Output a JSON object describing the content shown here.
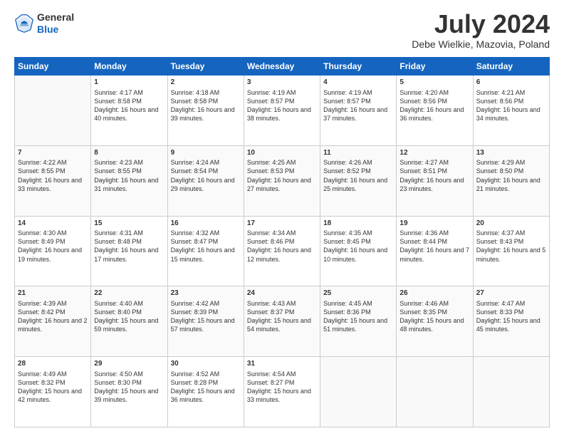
{
  "header": {
    "logo_general": "General",
    "logo_blue": "Blue",
    "month_title": "July 2024",
    "location": "Debe Wielkie, Mazovia, Poland"
  },
  "days_of_week": [
    "Sunday",
    "Monday",
    "Tuesday",
    "Wednesday",
    "Thursday",
    "Friday",
    "Saturday"
  ],
  "weeks": [
    [
      {
        "num": "",
        "sunrise": "",
        "sunset": "",
        "daylight": ""
      },
      {
        "num": "1",
        "sunrise": "Sunrise: 4:17 AM",
        "sunset": "Sunset: 8:58 PM",
        "daylight": "Daylight: 16 hours and 40 minutes."
      },
      {
        "num": "2",
        "sunrise": "Sunrise: 4:18 AM",
        "sunset": "Sunset: 8:58 PM",
        "daylight": "Daylight: 16 hours and 39 minutes."
      },
      {
        "num": "3",
        "sunrise": "Sunrise: 4:19 AM",
        "sunset": "Sunset: 8:57 PM",
        "daylight": "Daylight: 16 hours and 38 minutes."
      },
      {
        "num": "4",
        "sunrise": "Sunrise: 4:19 AM",
        "sunset": "Sunset: 8:57 PM",
        "daylight": "Daylight: 16 hours and 37 minutes."
      },
      {
        "num": "5",
        "sunrise": "Sunrise: 4:20 AM",
        "sunset": "Sunset: 8:56 PM",
        "daylight": "Daylight: 16 hours and 36 minutes."
      },
      {
        "num": "6",
        "sunrise": "Sunrise: 4:21 AM",
        "sunset": "Sunset: 8:56 PM",
        "daylight": "Daylight: 16 hours and 34 minutes."
      }
    ],
    [
      {
        "num": "7",
        "sunrise": "Sunrise: 4:22 AM",
        "sunset": "Sunset: 8:55 PM",
        "daylight": "Daylight: 16 hours and 33 minutes."
      },
      {
        "num": "8",
        "sunrise": "Sunrise: 4:23 AM",
        "sunset": "Sunset: 8:55 PM",
        "daylight": "Daylight: 16 hours and 31 minutes."
      },
      {
        "num": "9",
        "sunrise": "Sunrise: 4:24 AM",
        "sunset": "Sunset: 8:54 PM",
        "daylight": "Daylight: 16 hours and 29 minutes."
      },
      {
        "num": "10",
        "sunrise": "Sunrise: 4:25 AM",
        "sunset": "Sunset: 8:53 PM",
        "daylight": "Daylight: 16 hours and 27 minutes."
      },
      {
        "num": "11",
        "sunrise": "Sunrise: 4:26 AM",
        "sunset": "Sunset: 8:52 PM",
        "daylight": "Daylight: 16 hours and 25 minutes."
      },
      {
        "num": "12",
        "sunrise": "Sunrise: 4:27 AM",
        "sunset": "Sunset: 8:51 PM",
        "daylight": "Daylight: 16 hours and 23 minutes."
      },
      {
        "num": "13",
        "sunrise": "Sunrise: 4:29 AM",
        "sunset": "Sunset: 8:50 PM",
        "daylight": "Daylight: 16 hours and 21 minutes."
      }
    ],
    [
      {
        "num": "14",
        "sunrise": "Sunrise: 4:30 AM",
        "sunset": "Sunset: 8:49 PM",
        "daylight": "Daylight: 16 hours and 19 minutes."
      },
      {
        "num": "15",
        "sunrise": "Sunrise: 4:31 AM",
        "sunset": "Sunset: 8:48 PM",
        "daylight": "Daylight: 16 hours and 17 minutes."
      },
      {
        "num": "16",
        "sunrise": "Sunrise: 4:32 AM",
        "sunset": "Sunset: 8:47 PM",
        "daylight": "Daylight: 16 hours and 15 minutes."
      },
      {
        "num": "17",
        "sunrise": "Sunrise: 4:34 AM",
        "sunset": "Sunset: 8:46 PM",
        "daylight": "Daylight: 16 hours and 12 minutes."
      },
      {
        "num": "18",
        "sunrise": "Sunrise: 4:35 AM",
        "sunset": "Sunset: 8:45 PM",
        "daylight": "Daylight: 16 hours and 10 minutes."
      },
      {
        "num": "19",
        "sunrise": "Sunrise: 4:36 AM",
        "sunset": "Sunset: 8:44 PM",
        "daylight": "Daylight: 16 hours and 7 minutes."
      },
      {
        "num": "20",
        "sunrise": "Sunrise: 4:37 AM",
        "sunset": "Sunset: 8:43 PM",
        "daylight": "Daylight: 16 hours and 5 minutes."
      }
    ],
    [
      {
        "num": "21",
        "sunrise": "Sunrise: 4:39 AM",
        "sunset": "Sunset: 8:42 PM",
        "daylight": "Daylight: 16 hours and 2 minutes."
      },
      {
        "num": "22",
        "sunrise": "Sunrise: 4:40 AM",
        "sunset": "Sunset: 8:40 PM",
        "daylight": "Daylight: 15 hours and 59 minutes."
      },
      {
        "num": "23",
        "sunrise": "Sunrise: 4:42 AM",
        "sunset": "Sunset: 8:39 PM",
        "daylight": "Daylight: 15 hours and 57 minutes."
      },
      {
        "num": "24",
        "sunrise": "Sunrise: 4:43 AM",
        "sunset": "Sunset: 8:37 PM",
        "daylight": "Daylight: 15 hours and 54 minutes."
      },
      {
        "num": "25",
        "sunrise": "Sunrise: 4:45 AM",
        "sunset": "Sunset: 8:36 PM",
        "daylight": "Daylight: 15 hours and 51 minutes."
      },
      {
        "num": "26",
        "sunrise": "Sunrise: 4:46 AM",
        "sunset": "Sunset: 8:35 PM",
        "daylight": "Daylight: 15 hours and 48 minutes."
      },
      {
        "num": "27",
        "sunrise": "Sunrise: 4:47 AM",
        "sunset": "Sunset: 8:33 PM",
        "daylight": "Daylight: 15 hours and 45 minutes."
      }
    ],
    [
      {
        "num": "28",
        "sunrise": "Sunrise: 4:49 AM",
        "sunset": "Sunset: 8:32 PM",
        "daylight": "Daylight: 15 hours and 42 minutes."
      },
      {
        "num": "29",
        "sunrise": "Sunrise: 4:50 AM",
        "sunset": "Sunset: 8:30 PM",
        "daylight": "Daylight: 15 hours and 39 minutes."
      },
      {
        "num": "30",
        "sunrise": "Sunrise: 4:52 AM",
        "sunset": "Sunset: 8:28 PM",
        "daylight": "Daylight: 15 hours and 36 minutes."
      },
      {
        "num": "31",
        "sunrise": "Sunrise: 4:54 AM",
        "sunset": "Sunset: 8:27 PM",
        "daylight": "Daylight: 15 hours and 33 minutes."
      },
      {
        "num": "",
        "sunrise": "",
        "sunset": "",
        "daylight": ""
      },
      {
        "num": "",
        "sunrise": "",
        "sunset": "",
        "daylight": ""
      },
      {
        "num": "",
        "sunrise": "",
        "sunset": "",
        "daylight": ""
      }
    ]
  ]
}
